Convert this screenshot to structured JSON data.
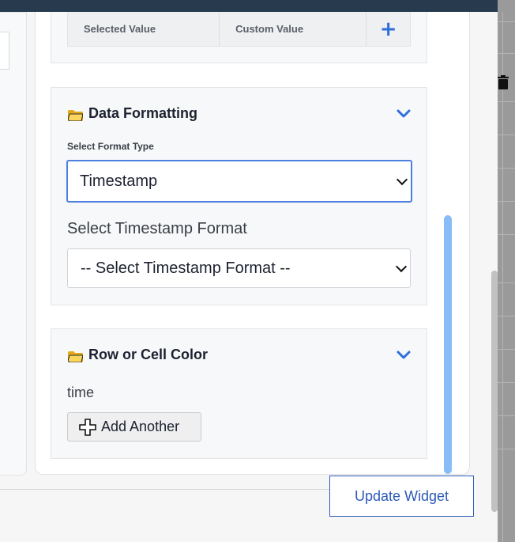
{
  "top_table": {
    "headers": [
      "Selected Value",
      "Custom Value"
    ],
    "add_icon": "plus-icon"
  },
  "data_formatting": {
    "title": "Data Formatting",
    "icon": "folder-icon",
    "format_type_label": "Select Format Type",
    "format_type_value": "Timestamp",
    "timestamp_format_label": "Select Timestamp Format",
    "timestamp_format_value": "-- Select Timestamp Format --"
  },
  "row_cell_color": {
    "title": "Row or Cell Color",
    "icon": "folder-icon",
    "field_label": "time",
    "add_button_label": "Add Another"
  },
  "footer": {
    "update_button_label": "Update Widget"
  },
  "colors": {
    "accent": "#2f6fdc",
    "scrollbar": "#87bdf7",
    "topbar": "#283a4e"
  }
}
